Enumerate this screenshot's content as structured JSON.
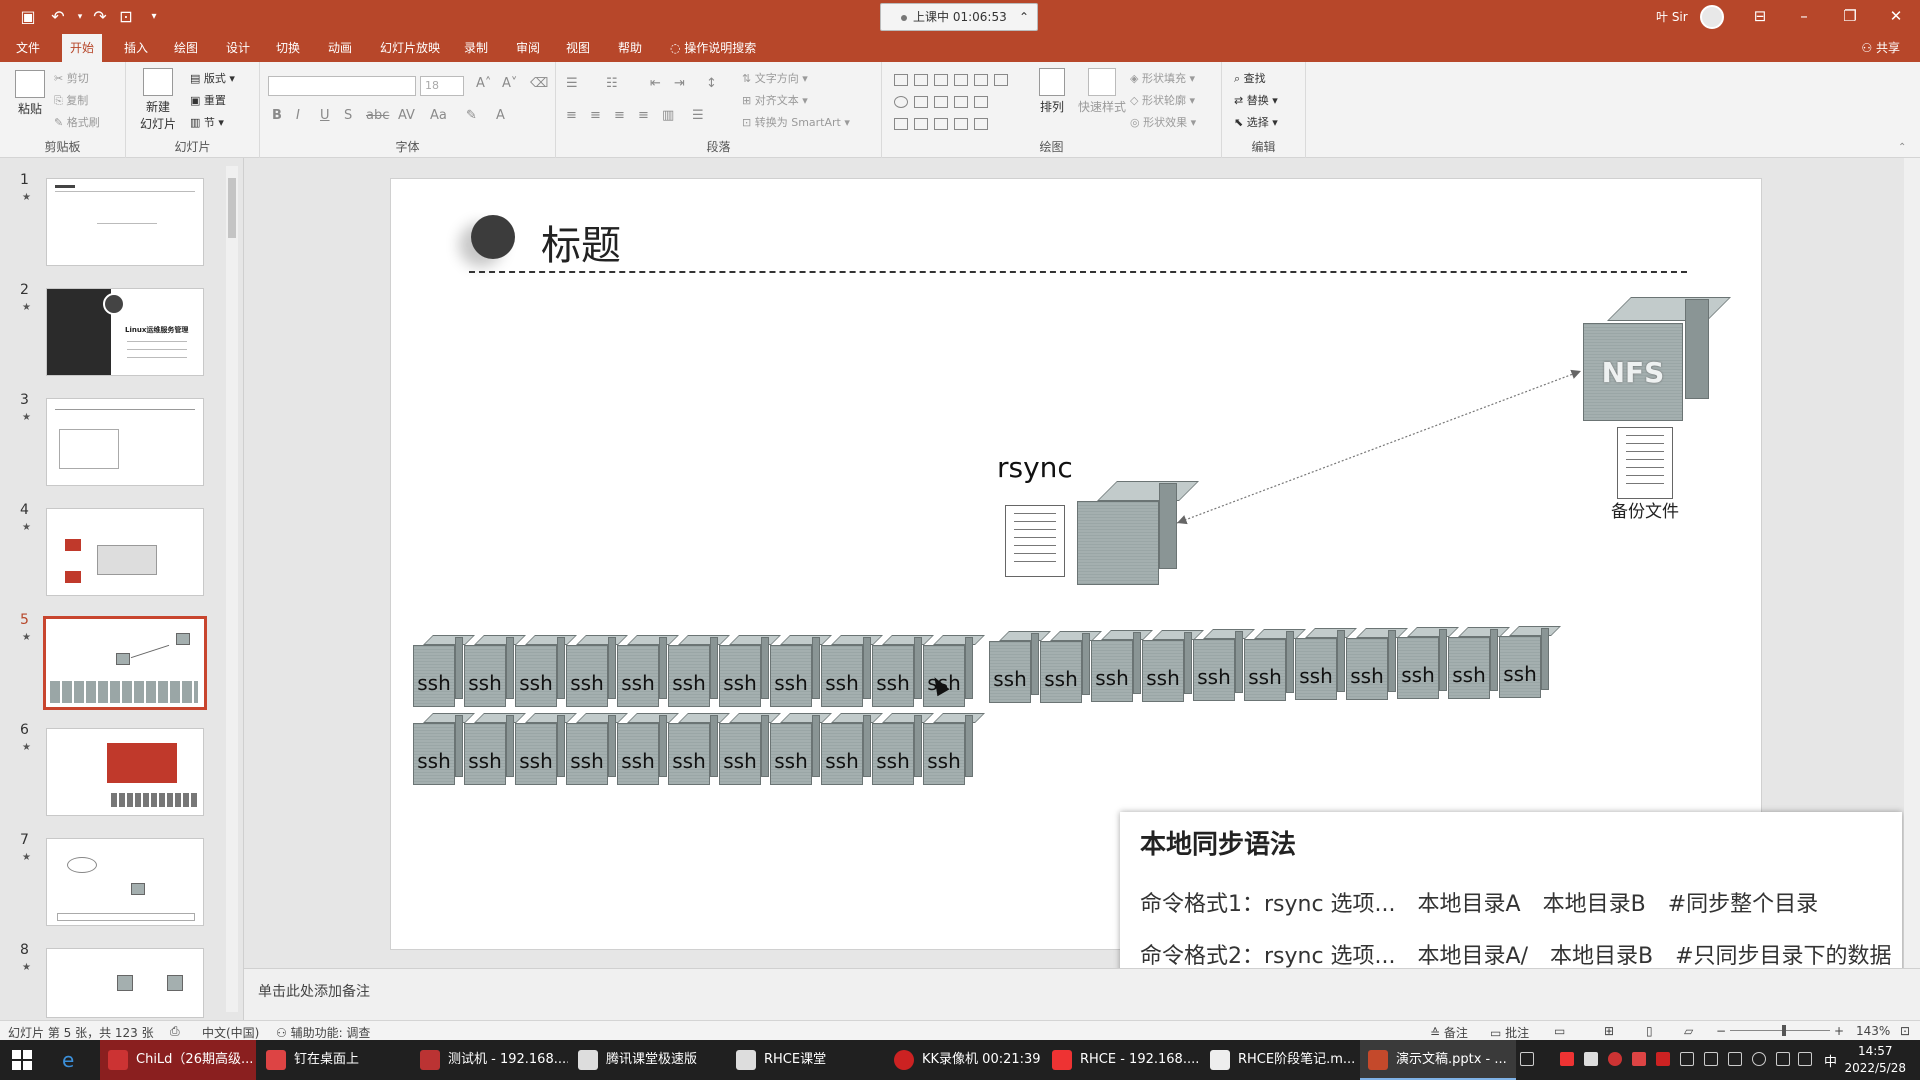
{
  "titlebar": {
    "recording_label": "上课中 01:06:53",
    "user_name": "叶 Sir"
  },
  "menu": {
    "tabs": [
      "文件",
      "开始",
      "插入",
      "绘图",
      "设计",
      "切换",
      "动画",
      "幻灯片放映",
      "录制",
      "审阅",
      "视图",
      "帮助"
    ],
    "active_tab": "开始",
    "tell_me": "操作说明搜索",
    "share": "共享"
  },
  "ribbon": {
    "clipboard": {
      "paste": "粘贴",
      "cut": "剪切",
      "copy": "复制",
      "format_painter": "格式刷",
      "group": "剪贴板"
    },
    "slides": {
      "new_slide": "新建",
      "new_slide2": "幻灯片",
      "layout": "版式",
      "reset": "重置",
      "section": "节",
      "group": "幻灯片"
    },
    "font": {
      "size": "18",
      "group": "字体"
    },
    "paragraph": {
      "text_direction": "文字方向",
      "align_text": "对齐文本",
      "smartart": "转换为 SmartArt",
      "group": "段落"
    },
    "drawing": {
      "arrange": "排列",
      "quick_styles": "快速样式",
      "shape_fill": "形状填充",
      "shape_outline": "形状轮廓",
      "shape_effects": "形状效果",
      "group": "绘图"
    },
    "editing": {
      "find": "查找",
      "replace": "替换",
      "select": "选择",
      "group": "编辑"
    }
  },
  "thumbnails": {
    "numbers": [
      "1",
      "2",
      "3",
      "4",
      "5",
      "6",
      "7",
      "8"
    ],
    "active": "5",
    "slide2_text": "Linux运维服务管理"
  },
  "slide": {
    "title": "标题",
    "rsync_label": "rsync",
    "nfs_label": "NFS",
    "backup_label": "备份文件",
    "server_label": "ssh"
  },
  "popup": {
    "title": "本地同步语法",
    "line1": [
      "命令格式1：rsync 选项...",
      "本地目录A",
      "本地目录B",
      "#同步整个目录"
    ],
    "line2": [
      "命令格式2：rsync 选项...",
      "本地目录A/",
      "本地目录B",
      "#只同步目录下的数据"
    ]
  },
  "notes": {
    "placeholder": "单击此处添加备注"
  },
  "statusbar": {
    "slide_info": "幻灯片 第 5 张，共 123 张",
    "language": "中文(中国)",
    "accessibility": "辅助功能: 调查",
    "notes": "备注",
    "comments": "批注",
    "zoom": "143%"
  },
  "taskbar": {
    "items": [
      "ChiLd（26期高级...",
      "钉在桌面上",
      "测试机 - 192.168....",
      "腾讯课堂极速版",
      "RHCE课堂",
      "KK录像机 00:21:39",
      "RHCE - 192.168....",
      "RHCE阶段笔记.m...",
      "演示文稿.pptx - ..."
    ],
    "time": "14:57",
    "date": "2022/5/28",
    "ime": "中"
  },
  "colors": {
    "accent": "#b7472a",
    "active_thumb": "#c8452e",
    "taskbar": "#202020"
  }
}
